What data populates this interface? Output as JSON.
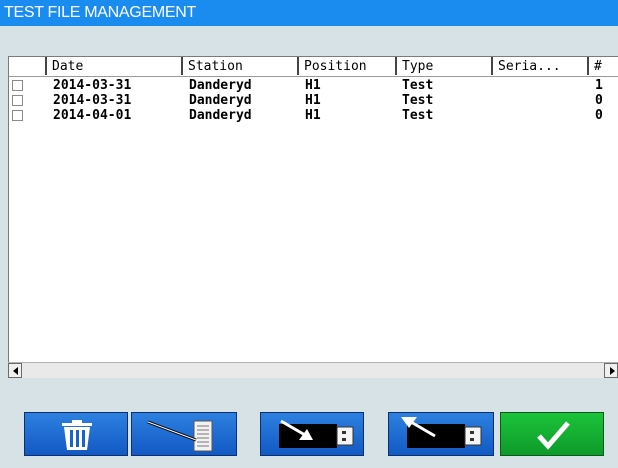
{
  "window": {
    "title": "TEST FILE MANAGEMENT"
  },
  "table": {
    "columns": [
      "Date",
      "Station",
      "Position",
      "Type",
      "Seria...",
      "#"
    ],
    "rows": [
      {
        "checked": false,
        "date": "2014-03-31",
        "station": "Danderyd",
        "position": "H1",
        "type": "Test",
        "serial": "",
        "count": "1"
      },
      {
        "checked": false,
        "date": "2014-03-31",
        "station": "Danderyd",
        "position": "H1",
        "type": "Test",
        "serial": "",
        "count": "0"
      },
      {
        "checked": false,
        "date": "2014-04-01",
        "station": "Danderyd",
        "position": "H1",
        "type": "Test",
        "serial": "",
        "count": "0"
      }
    ]
  },
  "toolbar": {
    "buttons": [
      {
        "icon": "trash-icon"
      },
      {
        "icon": "document-edit-icon"
      },
      {
        "icon": "usb-import-icon"
      },
      {
        "icon": "usb-export-icon"
      },
      {
        "icon": "checkmark-icon"
      }
    ]
  },
  "colors": {
    "titlebar": "#1a8cf0",
    "button_blue": "#1a6bd6",
    "button_green": "#13b334",
    "background": "#d6e2e5"
  }
}
